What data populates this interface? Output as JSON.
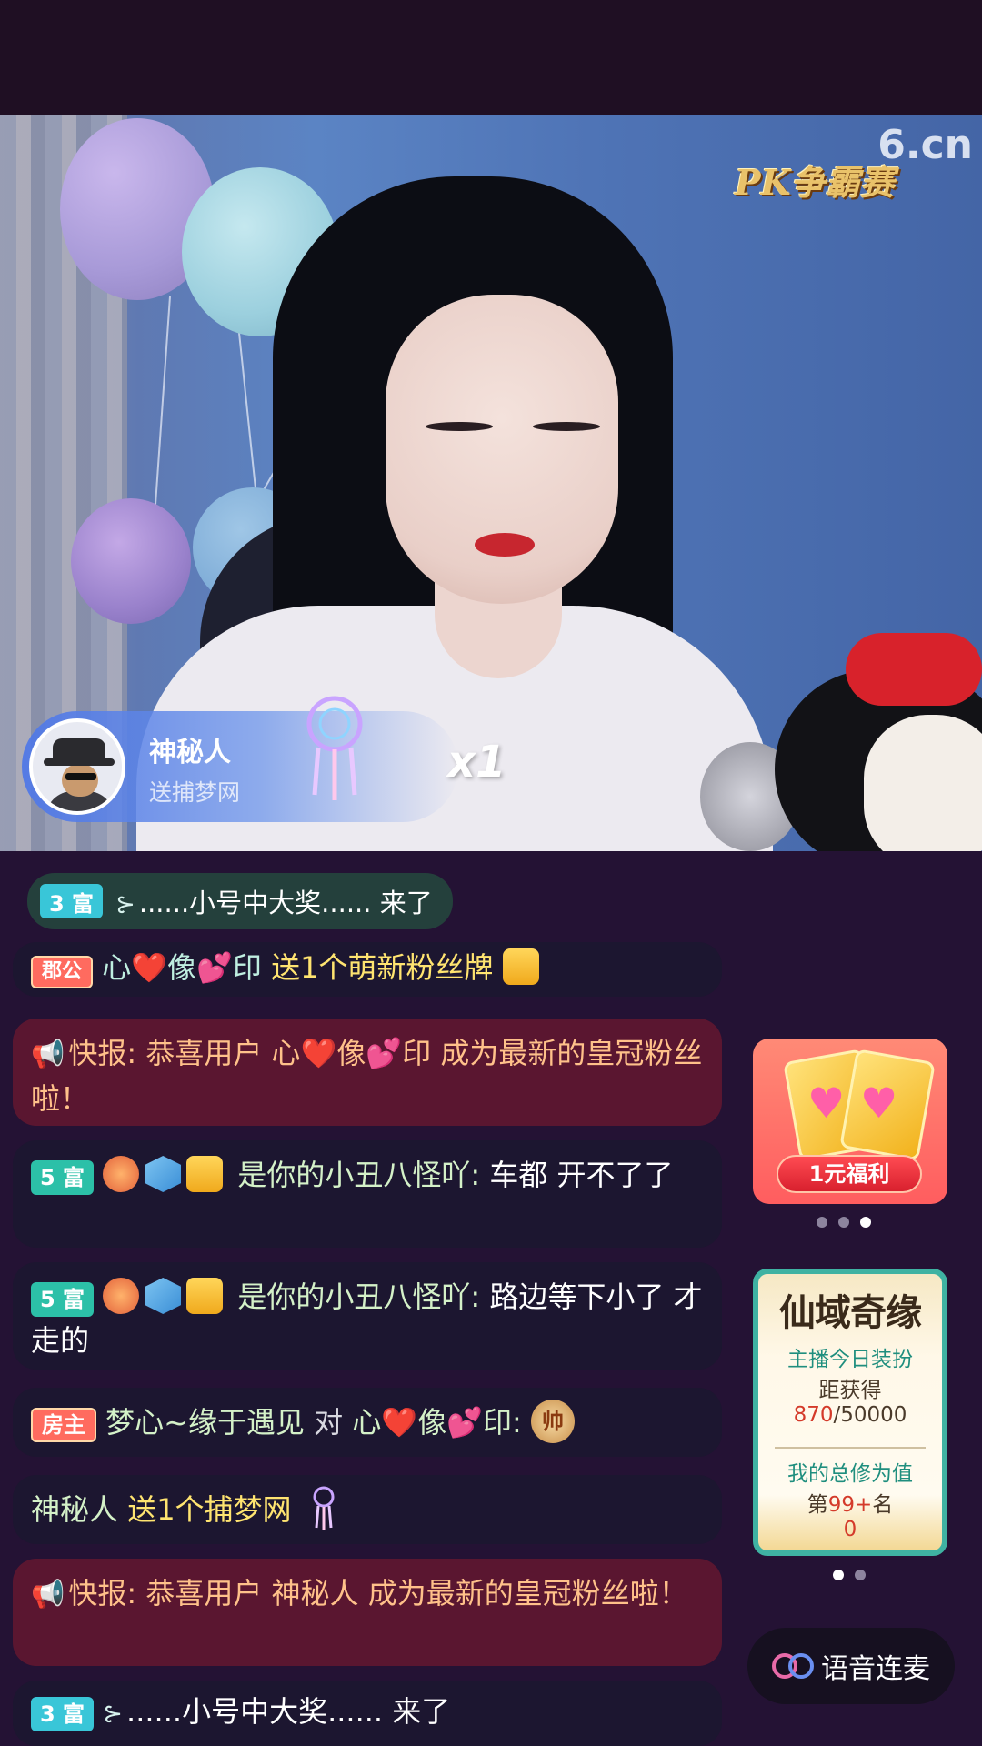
{
  "video": {
    "logo": "6.cn",
    "pk_logo": "PK争霸赛"
  },
  "gift_banner": {
    "sender": "神秘人",
    "action": "送捕梦网",
    "count": "x1"
  },
  "entry_notice": {
    "level": "3 富",
    "text": "......小号中大奖...... 来了"
  },
  "chat": {
    "partial": {
      "badge": "郡公",
      "user": "心❤️像💕印",
      "action": "送1个萌新粉丝牌"
    },
    "msg1": {
      "prefix": "快报:",
      "text_before": "恭喜用户",
      "user": "心❤️像💕印",
      "text_after": "成为最新的皇冠粉丝啦！"
    },
    "msg2": {
      "level": "5 富",
      "user": "是你的小丑八怪吖:",
      "text": "车都 开不了了"
    },
    "msg3": {
      "level": "5 富",
      "user": "是你的小丑八怪吖:",
      "text": "路边等下小了 才走的"
    },
    "msg4": {
      "badge": "房主",
      "user": "梦心~缘于遇见",
      "to": "对",
      "target": "心❤️像💕印:",
      "coin": "帅"
    },
    "msg5": {
      "user": "神秘人",
      "action": "送1个捕梦网"
    },
    "msg6": {
      "prefix": "快报:",
      "text_before": "恭喜用户",
      "user": "神秘人",
      "text_after": "成为最新的皇冠粉丝啦！"
    },
    "msg7": {
      "level": "3 富",
      "text": "......小号中大奖...... 来了"
    }
  },
  "promo": {
    "button": "1元福利",
    "pager_active": 2
  },
  "event": {
    "title": "仙域奇缘",
    "line1": "主播今日装扮",
    "line2": "距获得",
    "progress_current": "870",
    "progress_total": "/50000",
    "line3": "我的总修为值",
    "rank_prefix": "第",
    "rank": "99+",
    "rank_suffix": "名",
    "value": "0",
    "pager_active": 0
  },
  "voice_button": {
    "label": "语音连麦"
  },
  "colors": {
    "background": "#241234",
    "accent_yellow": "#ffe470",
    "alert_red": "#5a1630",
    "teal": "#3fb2a2"
  }
}
